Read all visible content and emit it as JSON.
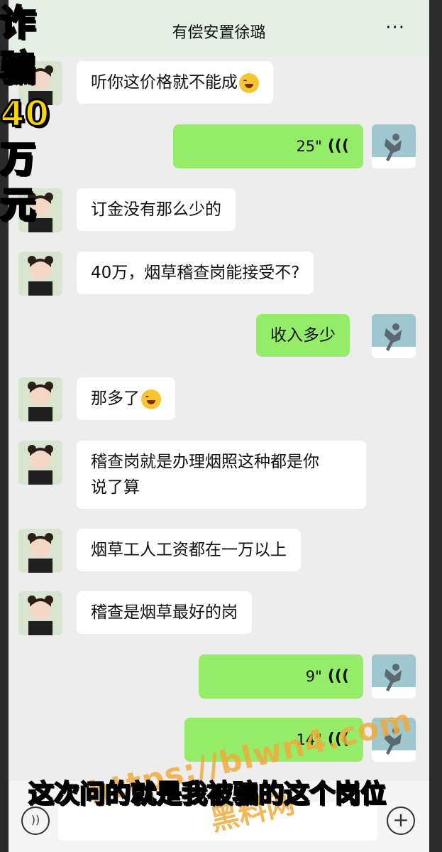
{
  "header": {
    "title": "有偿安置徐璐",
    "more": "···"
  },
  "overlay": {
    "left_text": "诈骗40万元"
  },
  "messages": [
    {
      "side": "left",
      "text": "听你这价格就不能成",
      "emoji": "😭"
    },
    {
      "side": "right",
      "type": "voice",
      "duration": "25\""
    },
    {
      "side": "left",
      "text": "订金没有那么少的"
    },
    {
      "side": "left",
      "text": "40万，烟草稽查岗能接受不?"
    },
    {
      "side": "right",
      "text": "收入多少"
    },
    {
      "side": "left",
      "text": "那多了",
      "emoji": "😂"
    },
    {
      "side": "left",
      "text_line1": "稽查岗就是办理烟照这种都是你",
      "text_line2": "说了算"
    },
    {
      "side": "left",
      "text": "烟草工人工资都在一万以上"
    },
    {
      "side": "left",
      "text": "稽查是烟草最好的岗"
    },
    {
      "side": "right",
      "type": "voice",
      "duration": "9\""
    },
    {
      "side": "right",
      "type": "voice",
      "duration": "14\""
    }
  ],
  "voice_icon": "(((",
  "subtitle": "这次问的就是我被骗的这个岗位",
  "watermark": {
    "url": "https://blwn4.com",
    "name": "黑料网"
  },
  "bottom": {
    "mic": "))",
    "plus": "+"
  }
}
